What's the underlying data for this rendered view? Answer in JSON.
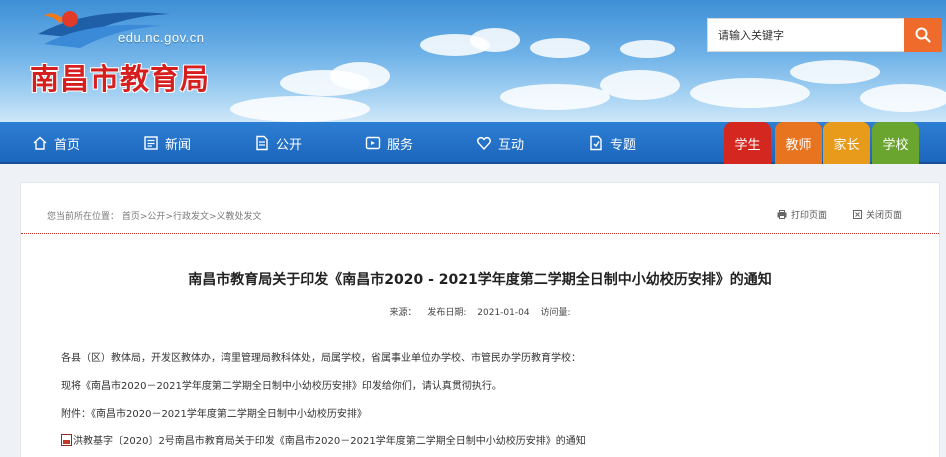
{
  "header": {
    "site_url": "edu.nc.gov.cn",
    "site_name": "南昌市教育局",
    "search_placeholder": "请输入关键字"
  },
  "nav": {
    "items": [
      {
        "label": "首页",
        "icon": "home-icon"
      },
      {
        "label": "新闻",
        "icon": "newspaper-icon"
      },
      {
        "label": "公开",
        "icon": "document-icon"
      },
      {
        "label": "服务",
        "icon": "service-icon"
      },
      {
        "label": "互动",
        "icon": "heart-icon"
      },
      {
        "label": "专题",
        "icon": "topic-icon"
      }
    ],
    "roles": [
      {
        "label": "学生",
        "color": "#d4271f"
      },
      {
        "label": "教师",
        "color": "#e8741f"
      },
      {
        "label": "家长",
        "color": "#e89a1a"
      },
      {
        "label": "学校",
        "color": "#6aa52f"
      }
    ]
  },
  "page": {
    "breadcrumb": "您当前所在位置： 首页>公开>行政发文>义教处发文",
    "print_label": "打印页面",
    "close_label": "关闭页面",
    "title": "南昌市教育局关于印发《南昌市2020 - 2021学年度第二学期全日制中小幼校历安排》的通知",
    "source_label": "来源：",
    "date_label": "发布日期:",
    "date_value": "2021-01-04",
    "visits_label": "访问量:",
    "body": {
      "p1": "各县（区）教体局，开发区教体办，湾里管理局教科体处，局属学校，省属事业单位办学校、市管民办学历教育学校：",
      "p2": "现将《南昌市2020－2021学年度第二学期全日制中小幼校历安排》印发给你们，请认真贯彻执行。",
      "p3": "附件：《南昌市2020－2021学年度第二学期全日制中小幼校历安排》",
      "attachment": "洪教基字〔2020〕2号南昌市教育局关于印发《南昌市2020－2021学年度第二学期全日制中小幼校历安排》的通知"
    }
  }
}
